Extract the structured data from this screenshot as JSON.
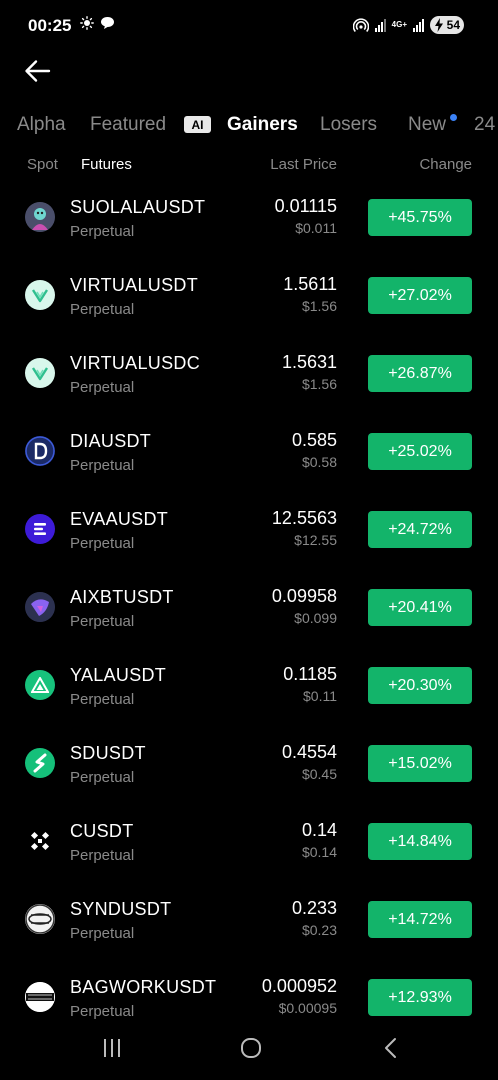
{
  "status": {
    "time": "00:25",
    "network": "4G+",
    "battery": "54"
  },
  "tabs": [
    {
      "label": "Alpha"
    },
    {
      "label": "Featured"
    },
    {
      "label": "Gainers"
    },
    {
      "label": "Losers"
    },
    {
      "label": "New"
    },
    {
      "label": "24"
    }
  ],
  "ai_badge": "AI",
  "subheader": {
    "spot": "Spot",
    "futures": "Futures",
    "last_price": "Last Price",
    "change": "Change"
  },
  "rows": [
    {
      "symbol": "SUOLALAUSDT",
      "type": "Perpetual",
      "price": "0.01115",
      "usd": "$0.011",
      "change": "+45.75%"
    },
    {
      "symbol": "VIRTUALUSDT",
      "type": "Perpetual",
      "price": "1.5611",
      "usd": "$1.56",
      "change": "+27.02%"
    },
    {
      "symbol": "VIRTUALUSDC",
      "type": "Perpetual",
      "price": "1.5631",
      "usd": "$1.56",
      "change": "+26.87%"
    },
    {
      "symbol": "DIAUSDT",
      "type": "Perpetual",
      "price": "0.585",
      "usd": "$0.58",
      "change": "+25.02%"
    },
    {
      "symbol": "EVAAUSDT",
      "type": "Perpetual",
      "price": "12.5563",
      "usd": "$12.55",
      "change": "+24.72%"
    },
    {
      "symbol": "AIXBTUSDT",
      "type": "Perpetual",
      "price": "0.09958",
      "usd": "$0.099",
      "change": "+20.41%"
    },
    {
      "symbol": "YALAUSDT",
      "type": "Perpetual",
      "price": "0.1185",
      "usd": "$0.11",
      "change": "+20.30%"
    },
    {
      "symbol": "SDUSDT",
      "type": "Perpetual",
      "price": "0.4554",
      "usd": "$0.45",
      "change": "+15.02%"
    },
    {
      "symbol": "CUSDT",
      "type": "Perpetual",
      "price": "0.14",
      "usd": "$0.14",
      "change": "+14.84%"
    },
    {
      "symbol": "SYNDUSDT",
      "type": "Perpetual",
      "price": "0.233",
      "usd": "$0.23",
      "change": "+14.72%"
    },
    {
      "symbol": "BAGWORKUSDT",
      "type": "Perpetual",
      "price": "0.000952",
      "usd": "$0.00095",
      "change": "+12.93%"
    }
  ],
  "colors": {
    "background": "#000000",
    "gain": "#13b46a",
    "muted": "#8a8a8a",
    "new_dot": "#3b82f6"
  },
  "icons": {
    "back": "arrow-left-icon",
    "nav_recents": "recents-icon",
    "nav_home": "home-icon",
    "nav_back": "chevron-left-icon"
  }
}
